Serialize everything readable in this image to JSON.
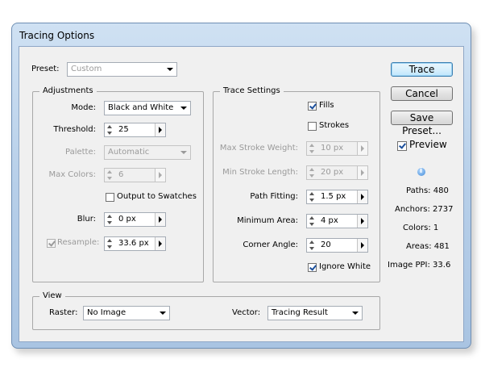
{
  "window": {
    "title": "Tracing Options"
  },
  "preset": {
    "label": "Preset:",
    "value": "Custom"
  },
  "adjustments": {
    "legend": "Adjustments",
    "mode_label": "Mode:",
    "mode_value": "Black and White",
    "threshold_label": "Threshold:",
    "threshold_value": "25",
    "palette_label": "Palette:",
    "palette_value": "Automatic",
    "max_colors_label": "Max Colors:",
    "max_colors_value": "6",
    "output_to_swatches_label": "Output to Swatches",
    "blur_label": "Blur:",
    "blur_value": "0 px",
    "resample_label": "Resample:",
    "resample_value": "33.6 px"
  },
  "trace_settings": {
    "legend": "Trace Settings",
    "fills_label": "Fills",
    "strokes_label": "Strokes",
    "max_stroke_weight_label": "Max Stroke Weight:",
    "max_stroke_weight_value": "10 px",
    "min_stroke_length_label": "Min Stroke Length:",
    "min_stroke_length_value": "20 px",
    "path_fitting_label": "Path Fitting:",
    "path_fitting_value": "1.5 px",
    "minimum_area_label": "Minimum Area:",
    "minimum_area_value": "4 px",
    "corner_angle_label": "Corner Angle:",
    "corner_angle_value": "20",
    "ignore_white_label": "Ignore White"
  },
  "view": {
    "legend": "View",
    "raster_label": "Raster:",
    "raster_value": "No Image",
    "vector_label": "Vector:",
    "vector_value": "Tracing Result"
  },
  "buttons": {
    "trace": "Trace",
    "cancel": "Cancel",
    "save_preset": "Save Preset..."
  },
  "preview": {
    "label": "Preview"
  },
  "stats": {
    "paths": "Paths: 480",
    "anchors": "Anchors: 2737",
    "colors": "Colors: 1",
    "areas": "Areas: 481",
    "image_ppi": "Image PPI: 33.6"
  },
  "icons": {
    "info": "info-icon"
  },
  "colors": {
    "default_button_border": "#3c7fb1",
    "title_bar": "#b7cfe9",
    "dialog_bg": "#f0f0f0"
  }
}
